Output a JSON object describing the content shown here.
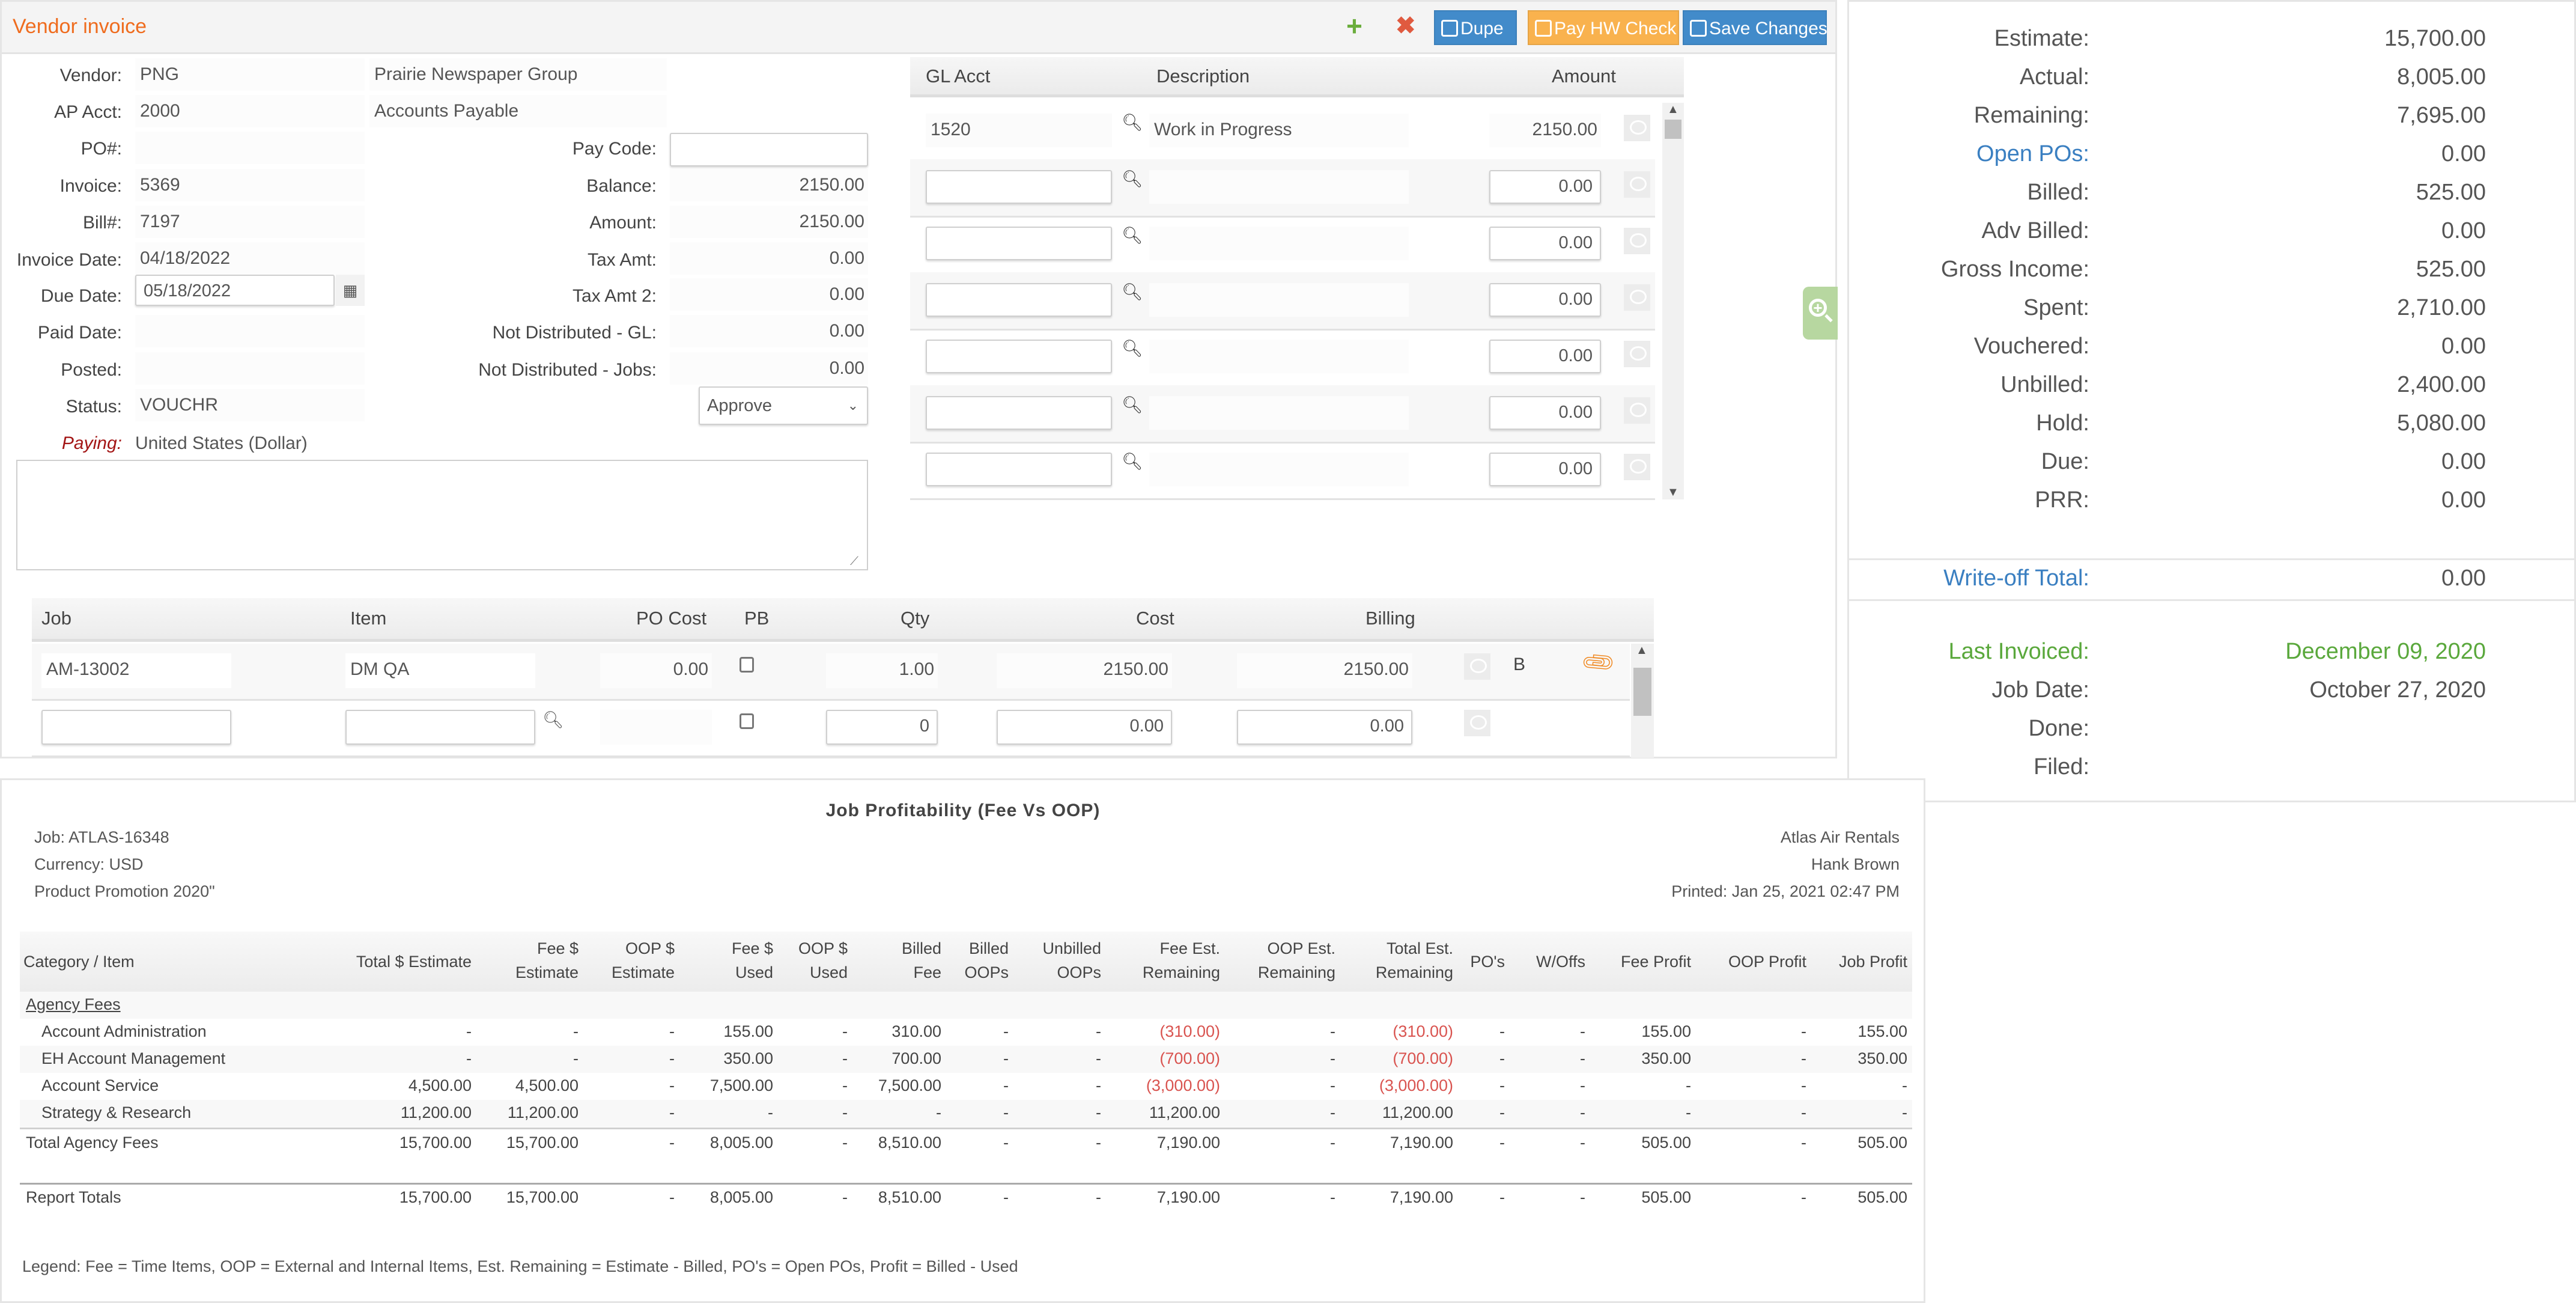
{
  "invoice": {
    "title": "Vendor invoice",
    "toolbar": {
      "add_icon": "plus-icon",
      "delete_icon": "x-icon",
      "dupe_label": "Dupe",
      "pay_label": "Pay HW Check",
      "save_label": "Save Changes",
      "colors": {
        "blue": "#428bca",
        "orange": "#f9b24e",
        "green": "#6aad3c",
        "red": "#e05a3f"
      }
    },
    "fields": {
      "vendor_label": "Vendor:",
      "vendor_code": "PNG",
      "vendor_name": "Prairie Newspaper Group",
      "ap_label": "AP Acct:",
      "ap_code": "2000",
      "ap_name": "Accounts Payable",
      "po_label": "PO#:",
      "po_value": "",
      "paycode_label": "Pay Code:",
      "paycode_value": "",
      "invoice_label": "Invoice:",
      "invoice_value": "5369",
      "balance_label": "Balance:",
      "balance_value": "2150.00",
      "bill_label": "Bill#:",
      "bill_value": "7197",
      "amount_label": "Amount:",
      "amount_value": "2150.00",
      "invdate_label": "Invoice Date:",
      "invdate_value": "04/18/2022",
      "taxamt_label": "Tax Amt:",
      "taxamt_value": "0.00",
      "duedate_label": "Due Date:",
      "duedate_value": "05/18/2022",
      "taxamt2_label": "Tax Amt 2:",
      "taxamt2_value": "0.00",
      "paiddate_label": "Paid Date:",
      "paiddate_value": "",
      "ndgl_label": "Not Distributed - GL:",
      "ndgl_value": "0.00",
      "posted_label": "Posted:",
      "posted_value": "",
      "ndjobs_label": "Not Distributed - Jobs:",
      "ndjobs_value": "0.00",
      "status_label": "Status:",
      "status_value": "VOUCHR",
      "action_select": "Approve",
      "paying_label": "Paying:",
      "paying_value": "United States (Dollar)",
      "notes_value": ""
    },
    "gl": {
      "headers": [
        "GL Acct",
        "Description",
        "Amount"
      ],
      "rows": [
        {
          "acct": "1520",
          "desc": "Work in Progress",
          "amount": "2150.00"
        },
        {
          "acct": "",
          "desc": "",
          "amount": "0.00"
        },
        {
          "acct": "",
          "desc": "",
          "amount": "0.00"
        },
        {
          "acct": "",
          "desc": "",
          "amount": "0.00"
        },
        {
          "acct": "",
          "desc": "",
          "amount": "0.00"
        },
        {
          "acct": "",
          "desc": "",
          "amount": "0.00"
        },
        {
          "acct": "",
          "desc": "",
          "amount": "0.00"
        }
      ]
    },
    "jobs": {
      "headers": [
        "Job",
        "Item",
        "PO Cost",
        "PB",
        "Qty",
        "Cost",
        "Billing"
      ],
      "rows": [
        {
          "job": "AM-13002",
          "item": "DM QA",
          "po_cost": "0.00",
          "qty": "1.00",
          "cost": "2150.00",
          "billing": "2150.00",
          "flag": "B"
        },
        {
          "job": "",
          "item": "",
          "po_cost": "",
          "qty": "0",
          "cost": "0.00",
          "billing": "0.00",
          "flag": ""
        }
      ]
    }
  },
  "summary": {
    "rows": [
      {
        "label": "Estimate:",
        "value": "15,700.00"
      },
      {
        "label": "Actual:",
        "value": "8,005.00"
      },
      {
        "label": "Remaining:",
        "value": "7,695.00"
      },
      {
        "label": "Open POs:",
        "value": "0.00",
        "link": true
      },
      {
        "label": "Billed:",
        "value": "525.00"
      },
      {
        "label": "Adv Billed:",
        "value": "0.00"
      },
      {
        "label": "Gross Income:",
        "value": "525.00"
      },
      {
        "label": "Spent:",
        "value": "2,710.00"
      },
      {
        "label": "Vouchered:",
        "value": "0.00"
      },
      {
        "label": "Unbilled:",
        "value": "2,400.00"
      },
      {
        "label": "Hold:",
        "value": "5,080.00"
      },
      {
        "label": "Due:",
        "value": "0.00"
      },
      {
        "label": "PRR:",
        "value": "0.00"
      }
    ],
    "writeoff": {
      "label": "Write-off Total:",
      "value": "0.00"
    },
    "dates": [
      {
        "label": "Last Invoiced:",
        "value": "December 09, 2020"
      },
      {
        "label": "Job Date:",
        "value": "October 27, 2020"
      },
      {
        "label": "Done:",
        "value": ""
      },
      {
        "label": "Filed:",
        "value": ""
      }
    ],
    "colors": {
      "link": "#3a7fc1",
      "green": "#5aa83c"
    }
  },
  "report": {
    "title": "Job Profitability (Fee Vs OOP)",
    "left_meta": [
      "Job: ATLAS-16348",
      "Currency: USD",
      "Product Promotion 2020\""
    ],
    "right_meta": [
      "Atlas Air Rentals",
      "Hank Brown",
      "Printed: Jan 25, 2021 02:47 PM"
    ],
    "columns": [
      [
        "Category / Item"
      ],
      [
        "Total $ Estimate"
      ],
      [
        "Fee $",
        "Estimate"
      ],
      [
        "OOP $",
        "Estimate"
      ],
      [
        "Fee $",
        "Used"
      ],
      [
        "OOP $",
        "Used"
      ],
      [
        "Billed",
        "Fee"
      ],
      [
        "Billed",
        "OOPs"
      ],
      [
        "Unbilled",
        "OOPs"
      ],
      [
        "Fee Est.",
        "Remaining"
      ],
      [
        "OOP Est.",
        "Remaining"
      ],
      [
        "Total Est.",
        "Remaining"
      ],
      [
        "PO's"
      ],
      [
        "W/Offs"
      ],
      [
        "Fee Profit"
      ],
      [
        "OOP Profit"
      ],
      [
        "Job Profit"
      ]
    ],
    "group": "Agency Fees",
    "rows": [
      {
        "name": "Account Administration",
        "cells": [
          "-",
          "-",
          "-",
          "155.00",
          "-",
          "310.00",
          "-",
          "-",
          "(310.00)",
          "-",
          "(310.00)",
          "-",
          "-",
          "155.00",
          "-",
          "155.00"
        ]
      },
      {
        "name": "EH Account Management",
        "cells": [
          "-",
          "-",
          "-",
          "350.00",
          "-",
          "700.00",
          "-",
          "-",
          "(700.00)",
          "-",
          "(700.00)",
          "-",
          "-",
          "350.00",
          "-",
          "350.00"
        ]
      },
      {
        "name": "Account Service",
        "cells": [
          "4,500.00",
          "4,500.00",
          "-",
          "7,500.00",
          "-",
          "7,500.00",
          "-",
          "-",
          "(3,000.00)",
          "-",
          "(3,000.00)",
          "-",
          "-",
          "-",
          "-",
          "-"
        ]
      },
      {
        "name": "Strategy & Research",
        "cells": [
          "11,200.00",
          "11,200.00",
          "-",
          "-",
          "-",
          "-",
          "-",
          "-",
          "11,200.00",
          "-",
          "11,200.00",
          "-",
          "-",
          "-",
          "-",
          "-"
        ]
      }
    ],
    "group_total": {
      "name": "Total Agency Fees",
      "cells": [
        "15,700.00",
        "15,700.00",
        "-",
        "8,005.00",
        "-",
        "8,510.00",
        "-",
        "-",
        "7,190.00",
        "-",
        "7,190.00",
        "-",
        "-",
        "505.00",
        "-",
        "505.00"
      ]
    },
    "report_total": {
      "name": "Report Totals",
      "cells": [
        "15,700.00",
        "15,700.00",
        "-",
        "8,005.00",
        "-",
        "8,510.00",
        "-",
        "-",
        "7,190.00",
        "-",
        "7,190.00",
        "-",
        "-",
        "505.00",
        "-",
        "505.00"
      ]
    },
    "legend": "Legend: Fee = Time Items,  OOP = External and Internal Items,  Est. Remaining = Estimate - Billed,  PO's = Open POs,  Profit = Billed - Used"
  }
}
